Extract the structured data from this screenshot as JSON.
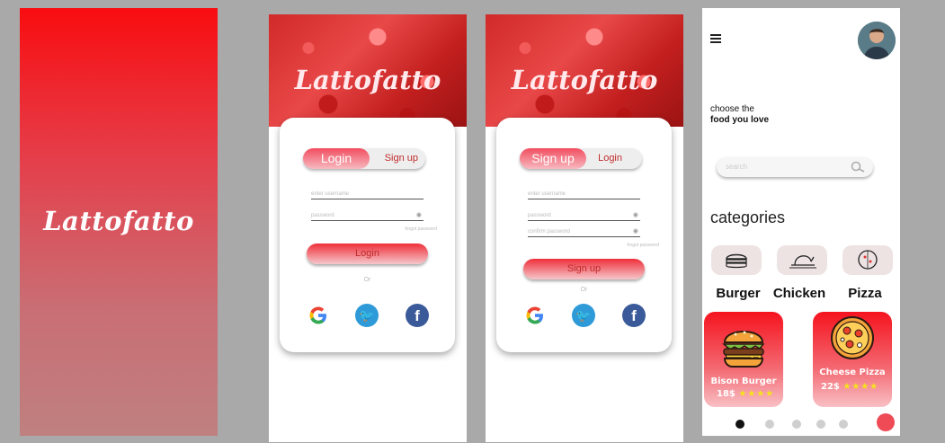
{
  "splash": {
    "brand": "Lattofatto"
  },
  "login": {
    "brand": "Lattofatto",
    "toggle_active": "Login",
    "toggle_inactive": "Sign up",
    "username_placeholder": "enter username",
    "password_placeholder": "password",
    "forgot": "forgot password",
    "submit": "Login",
    "or": "Or"
  },
  "signup": {
    "brand": "Lattofatto",
    "toggle_active": "Sign up",
    "toggle_inactive": "Login",
    "username_placeholder": "enter username",
    "password_placeholder": "password",
    "confirm_placeholder": "confirm password",
    "forgot": "forgot password",
    "submit": "Sign up",
    "or": "Or"
  },
  "home": {
    "tagline_line1": "choose the",
    "tagline_line2": "food you love",
    "search_placeholder": "search",
    "categories_title": "categories",
    "categories": [
      {
        "label": "Burger",
        "icon": "burger-icon"
      },
      {
        "label": "Chicken",
        "icon": "chicken-icon"
      },
      {
        "label": "Pizza",
        "icon": "pizza-icon"
      }
    ],
    "cards": [
      {
        "name": "Bison Burger",
        "price": "18$",
        "stars": "★★★★"
      },
      {
        "name": "Cheese Pizza",
        "price": "22$",
        "stars": "★★★★"
      }
    ]
  },
  "colors": {
    "brand_red": "#f80d10",
    "star_yellow": "#f6e21b",
    "facebook": "#3a5a99",
    "twitter": "#2f9ad8"
  }
}
